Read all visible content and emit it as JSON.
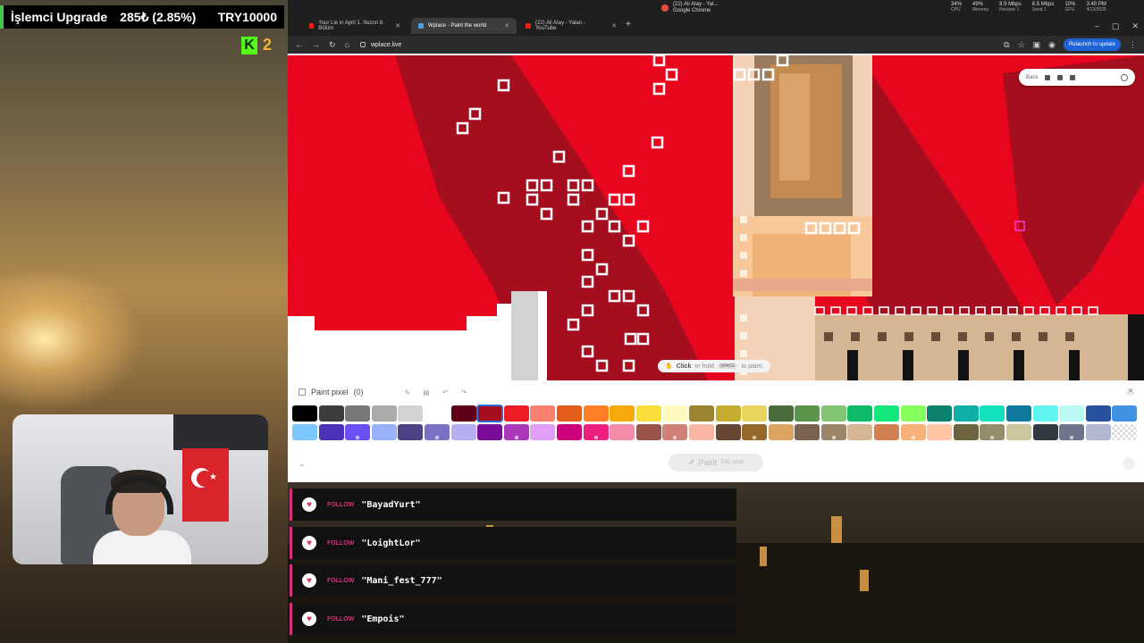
{
  "overlay": {
    "upgrade_label": "İşlemci Upgrade",
    "upgrade_progress": "285₺ (2.85%)",
    "upgrade_goal": "TRY10000",
    "kick_letter": "K",
    "kick_count": "2"
  },
  "browser": {
    "tabs": [
      {
        "title": "Your Lie in April 1. Sezon 8. Bölüm",
        "icon": "youtube-icon",
        "active": false
      },
      {
        "title": "Wplace - Paint the world",
        "icon": "wplace-icon",
        "active": true
      },
      {
        "title": "(22) Ali Atay - Yalan - YouTube",
        "icon": "youtube-icon",
        "active": false
      }
    ],
    "media_title": "(22) Ali Atay - Yal...",
    "media_sub": "Google Chrome",
    "url": "wplace.live",
    "relaunch_label": "Relaunch to update",
    "system": {
      "cpu": "34%",
      "cpu_label": "CPU",
      "memory": "49%",
      "memory_label": "Memory",
      "receive": "8.9 Mbps",
      "receive_label": "Receive 1",
      "send": "8.5 Mbps",
      "send_label": "Send 1",
      "gpu": "10%",
      "gpu_label": "GPU",
      "time": "3:40 PM",
      "date": "4/13/2025"
    }
  },
  "canvas": {
    "back_label": "Back",
    "hint_click": "Click",
    "hint_or_hold": "or hold",
    "hint_key": "SPACE",
    "hint_to_paint": "to paint."
  },
  "panel": {
    "title": "Paint pixel",
    "count": "(0)",
    "paint_label": "Paint",
    "paint_sub": "5/92 pixel",
    "palette": [
      "#000000",
      "#3c3c3c",
      "#787878",
      "#aaaaaa",
      "#d2d2d2",
      "#ffffff",
      "#600018",
      "#a50e1e",
      "#ed1c24",
      "#fa8072",
      "#e45c1a",
      "#ff7f27",
      "#f6aa09",
      "#f9dd3b",
      "#fffabc",
      "#9c8431",
      "#c5ad31",
      "#e8d45f",
      "#4a6b3a",
      "#5a944a",
      "#84c573",
      "#0eb968",
      "#13e67b",
      "#87ff5e",
      "#0c816e",
      "#10aea6",
      "#13e1be",
      "#0f799f",
      "#60f7f2",
      "#bbfaf2",
      "#28509e",
      "#4093e4",
      "#7dc7ff",
      "#4d31b8",
      "#6b50f6",
      "#99b1fb",
      "#4a4284",
      "#7a71c4",
      "#b5aef1",
      "#780c99",
      "#aa38b9",
      "#e09ff9",
      "#cb007a",
      "#ec1f80",
      "#f38da9",
      "#9b5249",
      "#d18078",
      "#fab6a4",
      "#684634",
      "#95682a",
      "#dba463",
      "#7b6352",
      "#9c846b",
      "#d6b594",
      "#d18051",
      "#f8b277",
      "#ffc5a5",
      "#6d643f",
      "#948c6b",
      "#cdc59e",
      "#333941",
      "#6d758d",
      "#b3b9d1",
      "transparent"
    ],
    "selected_index": 7
  },
  "alerts": [
    {
      "tag": "FOLLOW",
      "name": "\"BayadYurt\""
    },
    {
      "tag": "FOLLOW",
      "name": "\"LoightLor\""
    },
    {
      "tag": "FOLLOW",
      "name": "\"Mani_fest_777\""
    },
    {
      "tag": "FOLLOW",
      "name": "\"Empois\""
    }
  ]
}
